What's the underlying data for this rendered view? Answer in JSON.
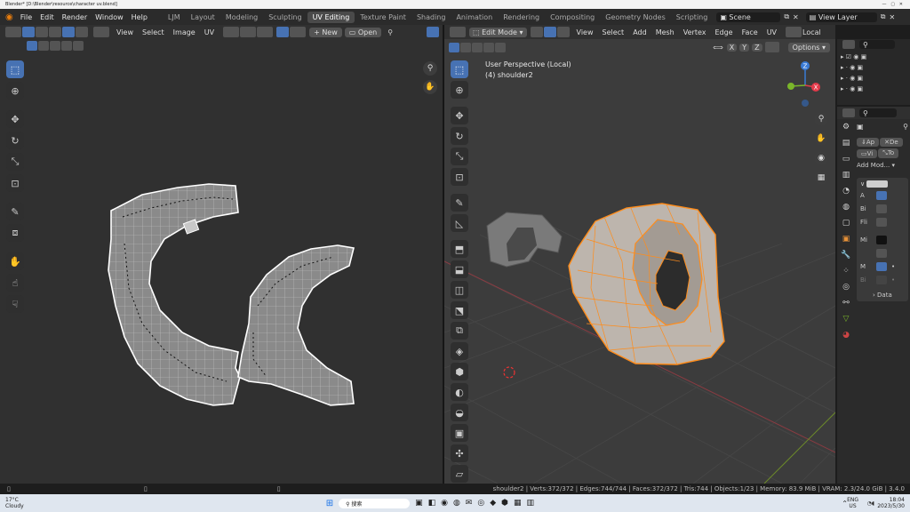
{
  "window": {
    "title": "Blender* [D:\\Blender\\resource\\character uv.blend]"
  },
  "topbar": {
    "menus": [
      "File",
      "Edit",
      "Render",
      "Window",
      "Help"
    ],
    "workspaces": [
      "LJM",
      "Layout",
      "Modeling",
      "Sculpting",
      "UV Editing",
      "Texture Paint",
      "Shading",
      "Animation",
      "Rendering",
      "Compositing",
      "Geometry Nodes",
      "Scripting"
    ],
    "active_workspace": "UV Editing",
    "scene": "Scene",
    "view_layer": "View Layer"
  },
  "uv_editor": {
    "menus": [
      "View",
      "Select",
      "Image",
      "UV"
    ],
    "new_label": "New",
    "open_label": "Open"
  },
  "viewport": {
    "mode": "Edit Mode",
    "menus": [
      "View",
      "Select",
      "Add",
      "Mesh",
      "Vertex",
      "Edge",
      "Face",
      "UV"
    ],
    "orientation": "Local",
    "axes": [
      "X",
      "Y",
      "Z"
    ],
    "options_label": "Options",
    "perspective": "User Perspective (Local)",
    "object_label": "(4) shoulder2",
    "gizmo": {
      "x": "X",
      "y": "Y",
      "z": "Z"
    }
  },
  "properties": {
    "apply": "Ap",
    "delete": "De",
    "viewport_btn": "Vi",
    "to_btn": "To",
    "add_modifier": "Add Mod...",
    "rows": [
      "A",
      "Bi",
      "Fli",
      "Mi",
      "M",
      "Bi"
    ],
    "data_label": "Data"
  },
  "statusbar": {
    "text": "shoulder2 | Verts:372/372 | Edges:744/744 | Faces:372/372 | Tris:744 | Objects:1/23 | Memory: 83.9 MiB | VRAM: 2.3/24.0 GiB | 3.4.0"
  },
  "taskbar": {
    "weather_temp": "17°C",
    "weather_desc": "Cloudy",
    "search": "搜索",
    "lang": "ENG",
    "region": "US",
    "time": "18:04",
    "date": "2023/5/30"
  },
  "colors": {
    "accent": "#4772b3",
    "selection": "#ff8c1a",
    "uv_edge": "#ffffff"
  }
}
